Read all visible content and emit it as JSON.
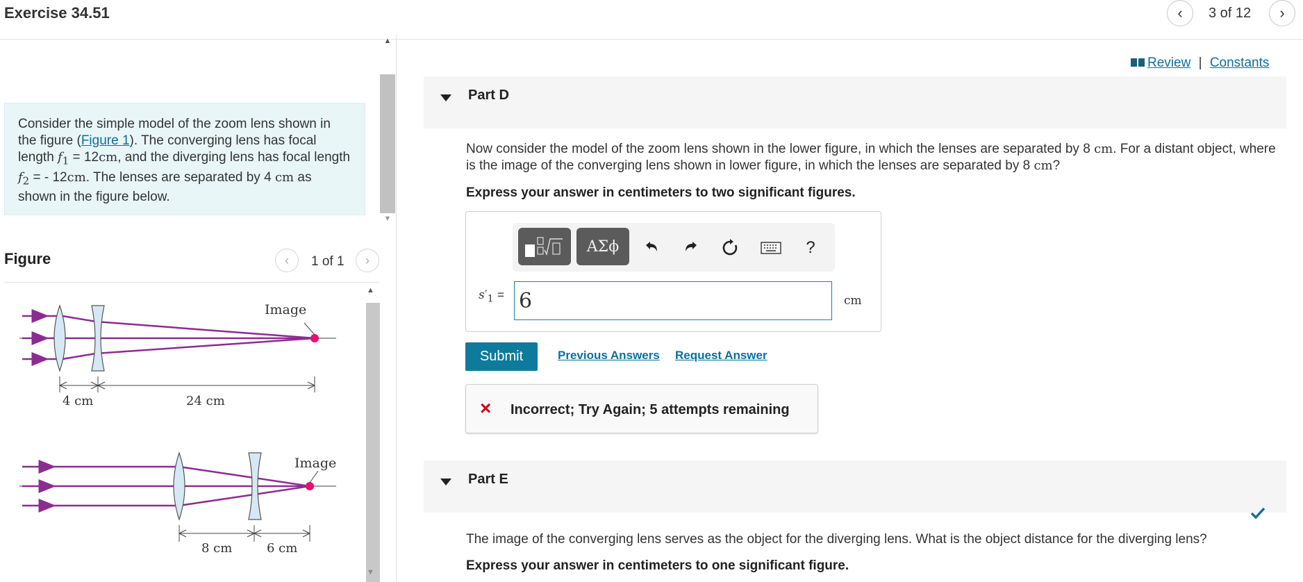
{
  "header": {
    "title": "Exercise 34.51",
    "page_counter": "3 of 12"
  },
  "intro": {
    "text_1": "Consider the simple model of the zoom lens shown in the figure (",
    "figure_link": "Figure 1",
    "text_2": "). The converging lens has focal length ",
    "f1_sym": "f",
    "f1_sub": "1",
    "text_3": " = 12",
    "f1_unit": "cm",
    "text_4": ", and the diverging lens has focal length ",
    "f2_sym": "f",
    "f2_sub": "2",
    "text_5": " = - 12",
    "f2_unit": "cm",
    "text_6": ". The lenses are separated by 4 ",
    "sep_unit": "cm",
    "text_7": " as shown in the figure below."
  },
  "figure": {
    "label": "Figure",
    "counter": "1 of 1",
    "top_diagram": {
      "image_label": "Image",
      "dim_small": "4 cm",
      "dim_large": "24 cm"
    },
    "bottom_diagram": {
      "image_label": "Image",
      "dim_left": "8 cm",
      "dim_right": "6 cm"
    },
    "colors": {
      "ray": "#8b2c91",
      "lens_fill": "#d6e8f5",
      "image_dot": "#e6106e"
    }
  },
  "links": {
    "review": "Review",
    "separator": "|",
    "constants": "Constants"
  },
  "partD": {
    "title": "Part D",
    "question_1": "Now consider the model of the zoom lens shown in the lower figure, in which the lenses are separated by 8 ",
    "question_unit1": "cm",
    "question_2": ". For a distant object, where is the image of the converging lens shown in lower figure, in which the lenses are separated by 8 ",
    "question_unit2": "cm",
    "question_3": "?",
    "instruction": "Express your answer in centimeters to two significant figures.",
    "toolbar": {
      "templates_icon": "template-icon",
      "greek_label": "ΑΣϕ",
      "undo_icon": "undo-icon",
      "redo_icon": "redo-icon",
      "reset_icon": "reset-icon",
      "keyboard_icon": "keyboard-icon",
      "help_label": "?"
    },
    "variable": "s",
    "variable_prime": "′",
    "variable_sub": "1",
    "equals": "=",
    "answer_value": "6",
    "unit": "cm",
    "submit_label": "Submit",
    "previous_answers": "Previous Answers",
    "request_answer": "Request Answer",
    "feedback_icon": "×",
    "feedback_text": "Incorrect; Try Again; 5 attempts remaining"
  },
  "partE": {
    "title": "Part E",
    "question": "The image of the converging lens serves as the object for the diverging lens. What is the object distance for the diverging lens?",
    "instruction": "Express your answer in centimeters to one significant figure.",
    "status_icon": "checkmark-icon"
  }
}
